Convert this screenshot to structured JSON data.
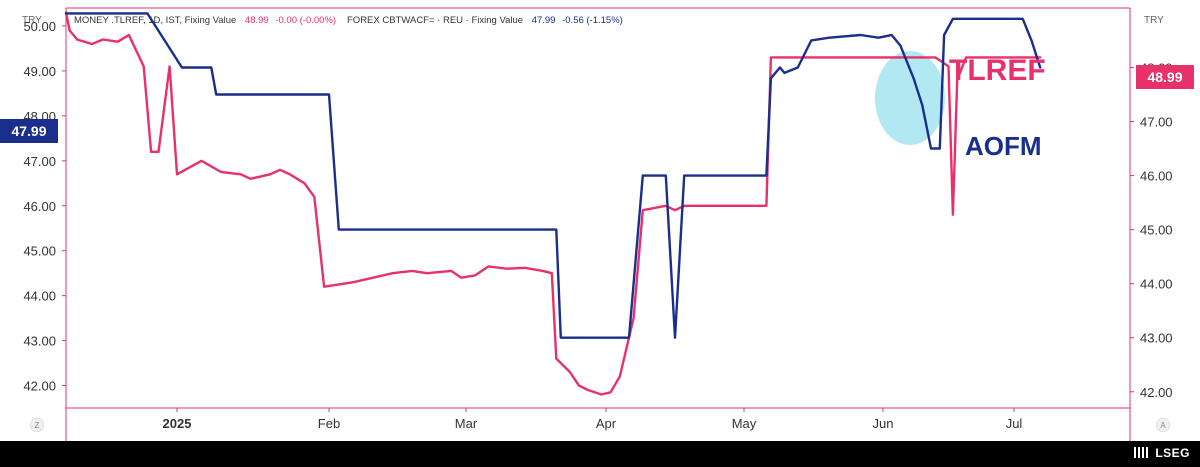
{
  "header": {
    "left_currency": "TRY",
    "right_currency": "TRY",
    "legend1": {
      "name": "MONEY .TLREF, 1D, IST, Fixing Value",
      "value": "48.99",
      "change": "-0.00 (-0.00%)",
      "color": "#e8316a"
    },
    "legend2": {
      "name": "FOREX CBTWACF= · REU · Fixing Value",
      "value": "47.99",
      "change": "-0.56 (-1.15%)",
      "color": "#1a2e8c"
    }
  },
  "annotations": {
    "tlref_label": "TLREF",
    "aofm_label": "AOFM",
    "highlight_color": "#7fd9e8"
  },
  "badges": {
    "left_value": "47.99",
    "right_value": "48.99"
  },
  "corners": {
    "left": "Z",
    "right": "A"
  },
  "footer": {
    "brand": "LSEG"
  },
  "chart_data": {
    "type": "line",
    "x_tick_labels": [
      "2025",
      "Feb",
      "Mar",
      "Apr",
      "May",
      "Jun",
      "Jul"
    ],
    "left_axis": {
      "ticks": [
        42.0,
        43.0,
        44.0,
        45.0,
        46.0,
        47.0,
        48.0,
        49.0,
        50.0
      ],
      "range": [
        41.5,
        50.4
      ]
    },
    "right_axis": {
      "ticks": [
        42.0,
        43.0,
        44.0,
        45.0,
        46.0,
        47.0,
        48.0
      ],
      "range": [
        41.7,
        49.1
      ]
    },
    "series": [
      {
        "name": "TLREF",
        "axis": "left",
        "color": "#e8316a",
        "points": [
          [
            "2024-12-02",
            50.3
          ],
          [
            "2024-12-03",
            49.9
          ],
          [
            "2024-12-05",
            49.7
          ],
          [
            "2024-12-09",
            49.6
          ],
          [
            "2024-12-12",
            49.7
          ],
          [
            "2024-12-16",
            49.65
          ],
          [
            "2024-12-19",
            49.8
          ],
          [
            "2024-12-23",
            49.1
          ],
          [
            "2024-12-25",
            47.2
          ],
          [
            "2024-12-27",
            47.2
          ],
          [
            "2024-12-30",
            49.1
          ],
          [
            "2025-01-01",
            46.7
          ],
          [
            "2025-01-06",
            47.0
          ],
          [
            "2025-01-10",
            46.75
          ],
          [
            "2025-01-14",
            46.7
          ],
          [
            "2025-01-16",
            46.6
          ],
          [
            "2025-01-20",
            46.7
          ],
          [
            "2025-01-22",
            46.8
          ],
          [
            "2025-01-24",
            46.7
          ],
          [
            "2025-01-27",
            46.5
          ],
          [
            "2025-01-29",
            46.2
          ],
          [
            "2025-01-31",
            44.2
          ],
          [
            "2025-02-03",
            44.25
          ],
          [
            "2025-02-06",
            44.3
          ],
          [
            "2025-02-10",
            44.4
          ],
          [
            "2025-02-14",
            44.5
          ],
          [
            "2025-02-18",
            44.55
          ],
          [
            "2025-02-21",
            44.5
          ],
          [
            "2025-02-26",
            44.55
          ],
          [
            "2025-02-28",
            44.4
          ],
          [
            "2025-03-03",
            44.45
          ],
          [
            "2025-03-06",
            44.65
          ],
          [
            "2025-03-10",
            44.6
          ],
          [
            "2025-03-14",
            44.62
          ],
          [
            "2025-03-18",
            44.55
          ],
          [
            "2025-03-20",
            44.5
          ],
          [
            "2025-03-21",
            42.6
          ],
          [
            "2025-03-24",
            42.3
          ],
          [
            "2025-03-26",
            42.0
          ],
          [
            "2025-03-28",
            41.9
          ],
          [
            "2025-03-31",
            41.8
          ],
          [
            "2025-04-02",
            41.85
          ],
          [
            "2025-04-04",
            42.2
          ],
          [
            "2025-04-07",
            43.5
          ],
          [
            "2025-04-09",
            45.9
          ],
          [
            "2025-04-14",
            46.0
          ],
          [
            "2025-04-16",
            45.9
          ],
          [
            "2025-04-18",
            46.0
          ],
          [
            "2025-05-06",
            46.0
          ],
          [
            "2025-05-07",
            49.3
          ],
          [
            "2025-06-13",
            49.3
          ],
          [
            "2025-06-16",
            49.1
          ],
          [
            "2025-06-17",
            45.8
          ],
          [
            "2025-06-18",
            48.8
          ],
          [
            "2025-06-20",
            49.3
          ],
          [
            "2025-07-07",
            49.3
          ]
        ]
      },
      {
        "name": "AOFM",
        "axis": "right",
        "color": "#1a2e8c",
        "points": [
          [
            "2024-12-02",
            49.0
          ],
          [
            "2024-12-24",
            49.0
          ],
          [
            "2025-01-02",
            48.0
          ],
          [
            "2025-01-08",
            48.0
          ],
          [
            "2025-01-09",
            47.5
          ],
          [
            "2025-02-01",
            47.5
          ],
          [
            "2025-02-03",
            45.0
          ],
          [
            "2025-03-21",
            45.0
          ],
          [
            "2025-03-22",
            43.0
          ],
          [
            "2025-04-06",
            43.0
          ],
          [
            "2025-04-09",
            46.0
          ],
          [
            "2025-04-14",
            46.0
          ],
          [
            "2025-04-16",
            43.0
          ],
          [
            "2025-04-18",
            46.0
          ],
          [
            "2025-05-06",
            46.0
          ],
          [
            "2025-05-07",
            47.8
          ],
          [
            "2025-05-09",
            48.0
          ],
          [
            "2025-05-10",
            47.9
          ],
          [
            "2025-05-13",
            48.0
          ],
          [
            "2025-05-16",
            48.5
          ],
          [
            "2025-05-20",
            48.55
          ],
          [
            "2025-05-27",
            48.6
          ],
          [
            "2025-05-31",
            48.55
          ],
          [
            "2025-06-03",
            48.6
          ],
          [
            "2025-06-05",
            48.4
          ],
          [
            "2025-06-08",
            47.8
          ],
          [
            "2025-06-10",
            47.3
          ],
          [
            "2025-06-12",
            46.5
          ],
          [
            "2025-06-14",
            46.5
          ],
          [
            "2025-06-15",
            48.6
          ],
          [
            "2025-06-17",
            48.9
          ],
          [
            "2025-07-03",
            48.9
          ],
          [
            "2025-07-05",
            48.5
          ],
          [
            "2025-07-07",
            48.0
          ]
        ]
      }
    ]
  }
}
